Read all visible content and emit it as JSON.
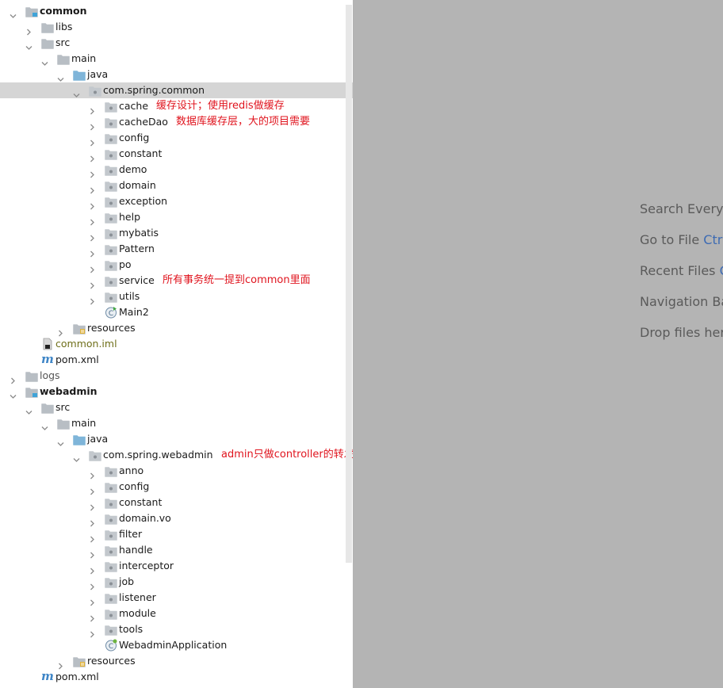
{
  "tree": [
    {
      "label": "common",
      "depth": 0,
      "expanded": true,
      "icon": "module-folder-icon",
      "bold": true
    },
    {
      "label": "libs",
      "depth": 1,
      "expanded": false,
      "icon": "folder-icon"
    },
    {
      "label": "src",
      "depth": 1,
      "expanded": true,
      "icon": "folder-icon"
    },
    {
      "label": "main",
      "depth": 2,
      "expanded": true,
      "icon": "folder-icon"
    },
    {
      "label": "java",
      "depth": 3,
      "expanded": true,
      "icon": "source-folder-icon"
    },
    {
      "label": "com.spring.common",
      "depth": 4,
      "expanded": true,
      "icon": "package-icon",
      "selected": true
    },
    {
      "label": "cache",
      "depth": 5,
      "expanded": false,
      "icon": "package-icon",
      "note": "缓存设计；使用redis做缓存"
    },
    {
      "label": "cacheDao",
      "depth": 5,
      "expanded": false,
      "icon": "package-icon",
      "note": "数据库缓存层，大的项目需要"
    },
    {
      "label": "config",
      "depth": 5,
      "expanded": false,
      "icon": "package-icon"
    },
    {
      "label": "constant",
      "depth": 5,
      "expanded": false,
      "icon": "package-icon"
    },
    {
      "label": "demo",
      "depth": 5,
      "expanded": false,
      "icon": "package-icon"
    },
    {
      "label": "domain",
      "depth": 5,
      "expanded": false,
      "icon": "package-icon"
    },
    {
      "label": "exception",
      "depth": 5,
      "expanded": false,
      "icon": "package-icon"
    },
    {
      "label": "help",
      "depth": 5,
      "expanded": false,
      "icon": "package-icon"
    },
    {
      "label": "mybatis",
      "depth": 5,
      "expanded": false,
      "icon": "package-icon"
    },
    {
      "label": "Pattern",
      "depth": 5,
      "expanded": false,
      "icon": "package-icon"
    },
    {
      "label": "po",
      "depth": 5,
      "expanded": false,
      "icon": "package-icon"
    },
    {
      "label": "service",
      "depth": 5,
      "expanded": false,
      "icon": "package-icon",
      "note": "所有事务统一提到common里面"
    },
    {
      "label": "utils",
      "depth": 5,
      "expanded": false,
      "icon": "package-icon"
    },
    {
      "label": "Main2",
      "depth": 5,
      "icon": "java-class-icon"
    },
    {
      "label": "resources",
      "depth": 3,
      "expanded": false,
      "icon": "resources-folder-icon"
    },
    {
      "label": "common.iml",
      "depth": 2,
      "icon": "iml-file-icon",
      "color": "olive"
    },
    {
      "label": "pom.xml",
      "depth": 2,
      "icon": "maven-icon"
    },
    {
      "label": "logs",
      "depth": 0,
      "expanded": false,
      "icon": "folder-icon",
      "color": "gray"
    },
    {
      "label": "webadmin",
      "depth": 0,
      "expanded": true,
      "icon": "module-folder-icon",
      "bold": true
    },
    {
      "label": "src",
      "depth": 1,
      "expanded": true,
      "icon": "folder-icon"
    },
    {
      "label": "main",
      "depth": 2,
      "expanded": true,
      "icon": "folder-icon"
    },
    {
      "label": "java",
      "depth": 3,
      "expanded": true,
      "icon": "source-folder-icon"
    },
    {
      "label": "com.spring.webadmin",
      "depth": 4,
      "expanded": true,
      "icon": "package-icon",
      "note": "admin只做controller的转发，数据处理和事务操作下沉到common里面"
    },
    {
      "label": "anno",
      "depth": 5,
      "expanded": false,
      "icon": "package-icon"
    },
    {
      "label": "config",
      "depth": 5,
      "expanded": false,
      "icon": "package-icon"
    },
    {
      "label": "constant",
      "depth": 5,
      "expanded": false,
      "icon": "package-icon"
    },
    {
      "label": "domain.vo",
      "depth": 5,
      "expanded": false,
      "icon": "package-icon"
    },
    {
      "label": "filter",
      "depth": 5,
      "expanded": false,
      "icon": "package-icon"
    },
    {
      "label": "handle",
      "depth": 5,
      "expanded": false,
      "icon": "package-icon"
    },
    {
      "label": "interceptor",
      "depth": 5,
      "expanded": false,
      "icon": "package-icon"
    },
    {
      "label": "job",
      "depth": 5,
      "expanded": false,
      "icon": "package-icon"
    },
    {
      "label": "listener",
      "depth": 5,
      "expanded": false,
      "icon": "package-icon"
    },
    {
      "label": "module",
      "depth": 5,
      "expanded": false,
      "icon": "package-icon"
    },
    {
      "label": "tools",
      "depth": 5,
      "expanded": false,
      "icon": "package-icon"
    },
    {
      "label": "WebadminApplication",
      "depth": 5,
      "icon": "spring-boot-class-icon"
    },
    {
      "label": "resources",
      "depth": 3,
      "expanded": false,
      "icon": "resources-folder-icon"
    },
    {
      "label": "pom.xml",
      "depth": 2,
      "icon": "maven-icon"
    }
  ],
  "editor_hints": [
    {
      "text": "Search Everyw",
      "key": ""
    },
    {
      "text": "Go to File ",
      "key": "Ctrl"
    },
    {
      "text": "Recent Files ",
      "key": "C"
    },
    {
      "text": "Navigation Ba",
      "key": ""
    },
    {
      "text": "Drop files here",
      "key": ""
    }
  ],
  "colors": {
    "annotation": "#e0141e",
    "selection": "#d5d5d5",
    "editor_background": "#b4b4b4",
    "shortcut": "#3d6bb3"
  }
}
